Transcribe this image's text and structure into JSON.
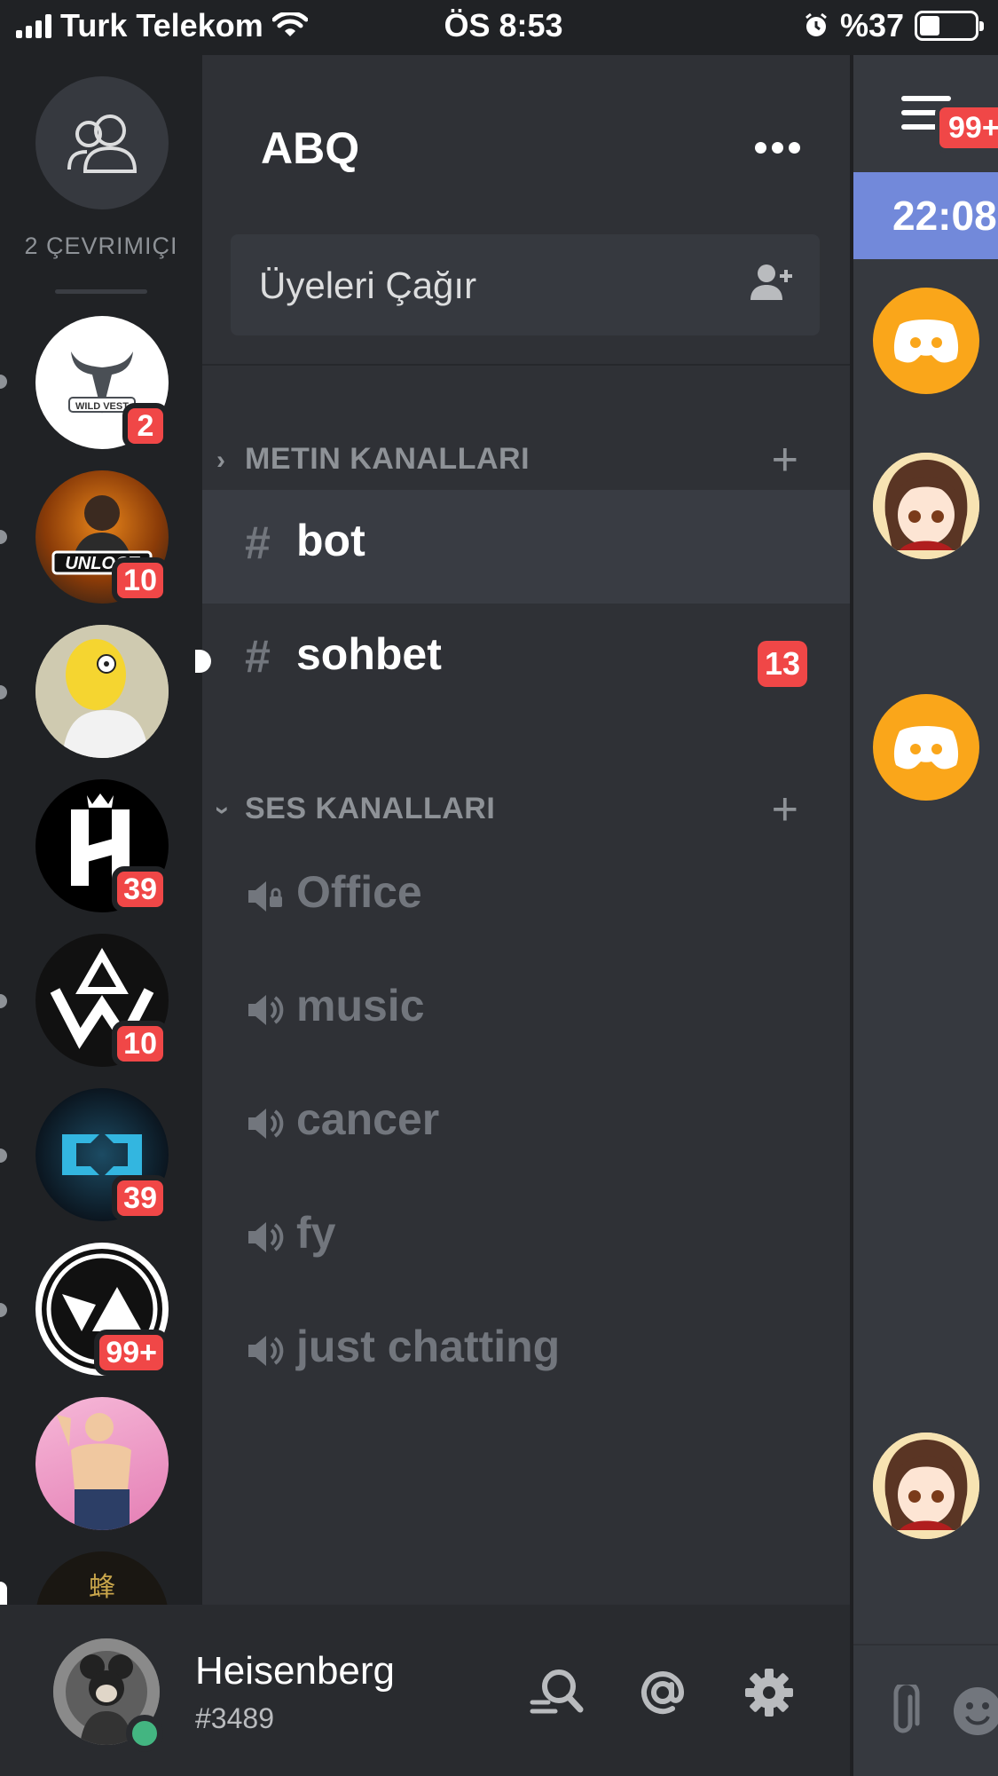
{
  "status_bar": {
    "carrier": "Turk Telekom",
    "time": "ÖS 8:53",
    "battery": "%37",
    "battery_level": 0.37
  },
  "guild_rail": {
    "online_count": "2 ÇEVRIMIÇI",
    "guilds": [
      {
        "name": "wild-west-server",
        "badge": "2"
      },
      {
        "name": "unlock-server",
        "badge": "10"
      },
      {
        "name": "simpson-server",
        "badge": ""
      },
      {
        "name": "h-server",
        "badge": "39"
      },
      {
        "name": "w-server",
        "badge": "10"
      },
      {
        "name": "cyan-logo-server",
        "badge": "39"
      },
      {
        "name": "va-server",
        "badge": "99+"
      },
      {
        "name": "anime-muscle-server",
        "badge": ""
      },
      {
        "name": "bee-server",
        "badge": ""
      }
    ]
  },
  "server": {
    "name": "ABQ",
    "invite_label": "Üyeleri Çağır",
    "text_category": "METIN KANALLARI",
    "voice_category": "SES KANALLARI",
    "text_channels": [
      {
        "name": "bot",
        "mentions": ""
      },
      {
        "name": "sohbet",
        "mentions": "13"
      }
    ],
    "voice_channels": [
      {
        "name": "Office"
      },
      {
        "name": "music"
      },
      {
        "name": "cancer"
      },
      {
        "name": "fy"
      },
      {
        "name": "just chatting"
      }
    ]
  },
  "user": {
    "name": "Heisenberg",
    "discriminator": "#3489"
  },
  "chat_peek": {
    "badge": "99+",
    "time": "22:08"
  },
  "colors": {
    "rail_bg": "#202225",
    "channels_bg": "#2f3136",
    "chat_bg": "#36393f",
    "mention_red": "#f04747",
    "blurple": "#7289da",
    "online_green": "#43b581"
  }
}
